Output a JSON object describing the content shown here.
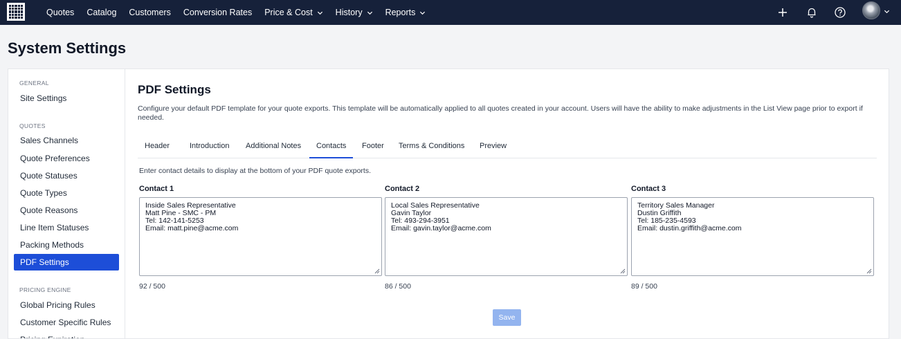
{
  "nav": {
    "items": [
      {
        "label": "Quotes",
        "dropdown": false
      },
      {
        "label": "Catalog",
        "dropdown": false
      },
      {
        "label": "Customers",
        "dropdown": false
      },
      {
        "label": "Conversion Rates",
        "dropdown": false
      },
      {
        "label": "Price & Cost",
        "dropdown": true
      },
      {
        "label": "History",
        "dropdown": true
      },
      {
        "label": "Reports",
        "dropdown": true
      }
    ],
    "icons": [
      "plus-icon",
      "bell-icon",
      "help-icon",
      "avatar"
    ]
  },
  "page": {
    "title": "System Settings"
  },
  "sidebar": {
    "sections": [
      {
        "title": "GENERAL",
        "items": [
          {
            "label": "Site Settings"
          }
        ]
      },
      {
        "title": "QUOTES",
        "items": [
          {
            "label": "Sales Channels"
          },
          {
            "label": "Quote Preferences"
          },
          {
            "label": "Quote Statuses"
          },
          {
            "label": "Quote Types"
          },
          {
            "label": "Quote Reasons"
          },
          {
            "label": "Line Item Statuses"
          },
          {
            "label": "Packing Methods"
          },
          {
            "label": "PDF Settings",
            "active": true
          }
        ]
      },
      {
        "title": "PRICING ENGINE",
        "items": [
          {
            "label": "Global Pricing Rules"
          },
          {
            "label": "Customer Specific Rules"
          },
          {
            "label": "Pricing Expiration"
          }
        ]
      }
    ]
  },
  "main": {
    "title": "PDF Settings",
    "description": "Configure your default PDF template for your quote exports. This template will be automatically applied to all quotes created in your account. Users will have the ability to make adjustments in the List View page prior to export if needed.",
    "tabs": [
      {
        "label": "Header"
      },
      {
        "label": "Introduction"
      },
      {
        "label": "Additional Notes"
      },
      {
        "label": "Contacts",
        "active": true
      },
      {
        "label": "Footer"
      },
      {
        "label": "Terms & Conditions"
      },
      {
        "label": "Preview"
      }
    ],
    "intro": "Enter contact details to display at the bottom of your PDF quote exports.",
    "contacts": [
      {
        "label": "Contact 1",
        "lines": [
          "Inside Sales Representative",
          "Matt Pine - SMC - PM",
          "Tel: 142-141-5253",
          "Email: matt.pine@acme.com"
        ],
        "count": "92 / 500"
      },
      {
        "label": "Contact 2",
        "lines": [
          "Local Sales Representative",
          "Gavin Taylor",
          "Tel: 493-294-3951",
          "Email: gavin.taylor@acme.com"
        ],
        "count": "86 / 500"
      },
      {
        "label": "Contact 3",
        "lines": [
          "Territory Sales Manager",
          "Dustin Griffith",
          "Tel: 185-235-4593",
          "Email: dustin.griffith@acme.com"
        ],
        "count": "89 / 500"
      }
    ],
    "save_label": "Save"
  },
  "colors": {
    "navbar": "#16213a",
    "accent": "#1d4ed8",
    "save_disabled": "#93b4ef"
  }
}
